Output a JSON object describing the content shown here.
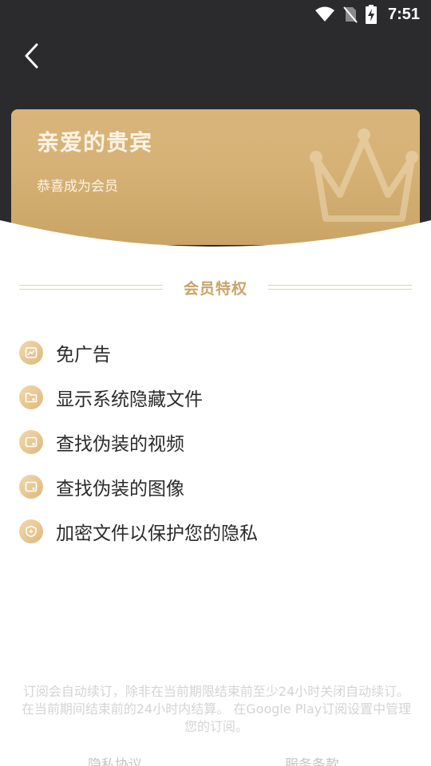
{
  "status_bar": {
    "time": "7:51",
    "icons": [
      "wifi-icon",
      "no-sim-icon",
      "battery-charging-icon"
    ]
  },
  "nav": {
    "back_icon": "chevron-left-icon"
  },
  "card": {
    "title": "亲爱的贵宾",
    "subtitle": "恭喜成为会员",
    "decoration": "crown-icon"
  },
  "section": {
    "title": "会员特权"
  },
  "features": [
    {
      "label": "免广告",
      "icon": "no-ads-icon"
    },
    {
      "label": "显示系统隐藏文件",
      "icon": "folder-icon"
    },
    {
      "label": "查找伪装的视频",
      "icon": "video-icon"
    },
    {
      "label": "查找伪装的图像",
      "icon": "image-icon"
    },
    {
      "label": "加密文件以保护您的隐私",
      "icon": "shield-icon"
    }
  ],
  "notice": "订阅会自动续订，除非在当前期限结束前至少24小时关闭自动续订。 在当前期间结束前的24小时内结算。 在Google Play订阅设置中管理您的订阅。",
  "footer": {
    "privacy": "隐私协议",
    "terms": "服务条款"
  },
  "colors": {
    "header_bg": "#2b2b2e",
    "gold": "#c9a468",
    "card_gold": "#d9b57b",
    "text_dark": "#2b2b2b",
    "text_muted": "#d4d4d4"
  }
}
